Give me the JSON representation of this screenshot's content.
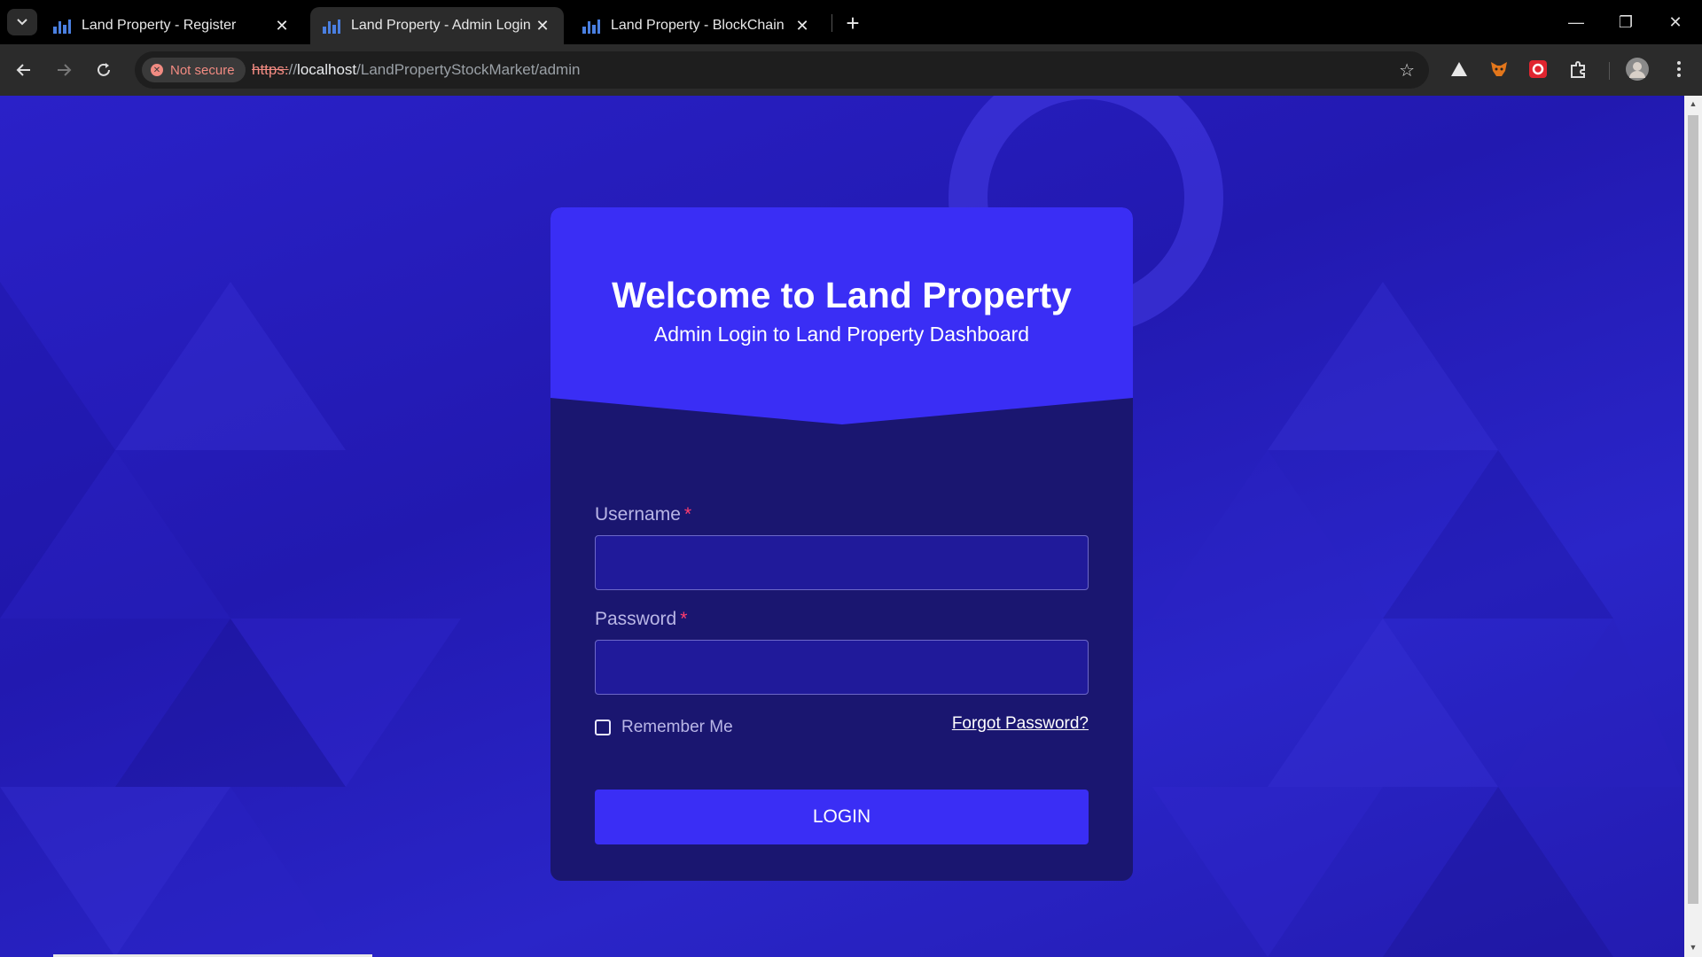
{
  "browser": {
    "tabs": [
      {
        "title": "Land Property - Register",
        "active": false
      },
      {
        "title": "Land Property - Admin Login",
        "active": true
      },
      {
        "title": "Land Property - BlockChain",
        "active": false
      }
    ],
    "security_label": "Not secure",
    "url": {
      "scheme": "https:",
      "rest_prefix": "//",
      "host": "localhost",
      "path": "/LandPropertyStockMarket/admin"
    },
    "extensions": [
      "triangle-icon",
      "metamask-fox-icon",
      "red-extension-icon",
      "puzzle-icon",
      "avatar"
    ]
  },
  "login": {
    "heading": "Welcome to Land Property",
    "subheading": "Admin Login to Land Property Dashboard",
    "username_label": "Username",
    "password_label": "Password",
    "required_mark": "*",
    "username_value": "",
    "password_value": "",
    "remember_label": "Remember Me",
    "remember_checked": false,
    "forgot_label": "Forgot Password?",
    "login_button": "LOGIN"
  },
  "colors": {
    "accent": "#3a2ef5",
    "card_body": "#1a1670",
    "required": "#ff3d6e"
  }
}
